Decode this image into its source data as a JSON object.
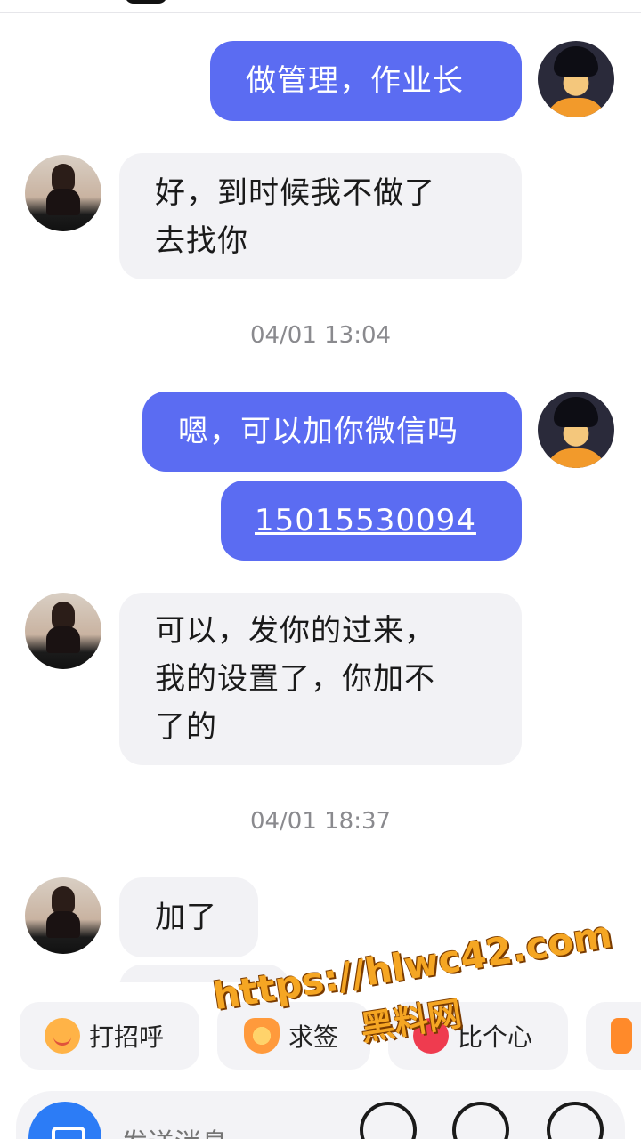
{
  "messages": [
    {
      "side": "me",
      "text": "做管理，作业长"
    },
    {
      "side": "them",
      "lines": [
        "好，到时候我不做了",
        "去找你"
      ]
    },
    {
      "type": "timestamp",
      "text": "04/01 13:04"
    },
    {
      "side": "me",
      "text": "嗯，可以加你微信吗"
    },
    {
      "side": "me",
      "text": "15015530094",
      "is_link": true
    },
    {
      "side": "them",
      "lines": [
        "可以，发你的过来，",
        "我的设置了，你加不",
        "了的"
      ]
    },
    {
      "type": "timestamp",
      "text": "04/01 18:37"
    },
    {
      "side": "them",
      "text": "加了"
    }
  ],
  "quick_actions": [
    {
      "label": "打招呼",
      "icon": "smile-icon"
    },
    {
      "label": "求签",
      "icon": "flower-icon"
    },
    {
      "label": "比个心",
      "icon": "heart-icon"
    }
  ],
  "composer": {
    "placeholder": "发送消息"
  },
  "watermark": {
    "url": "https://hlwc42.com",
    "name": "黑料网"
  },
  "colors": {
    "my_bubble": "#5b6cf2",
    "their_bubble": "#f2f2f5",
    "timestamp": "#8a8a8e"
  }
}
